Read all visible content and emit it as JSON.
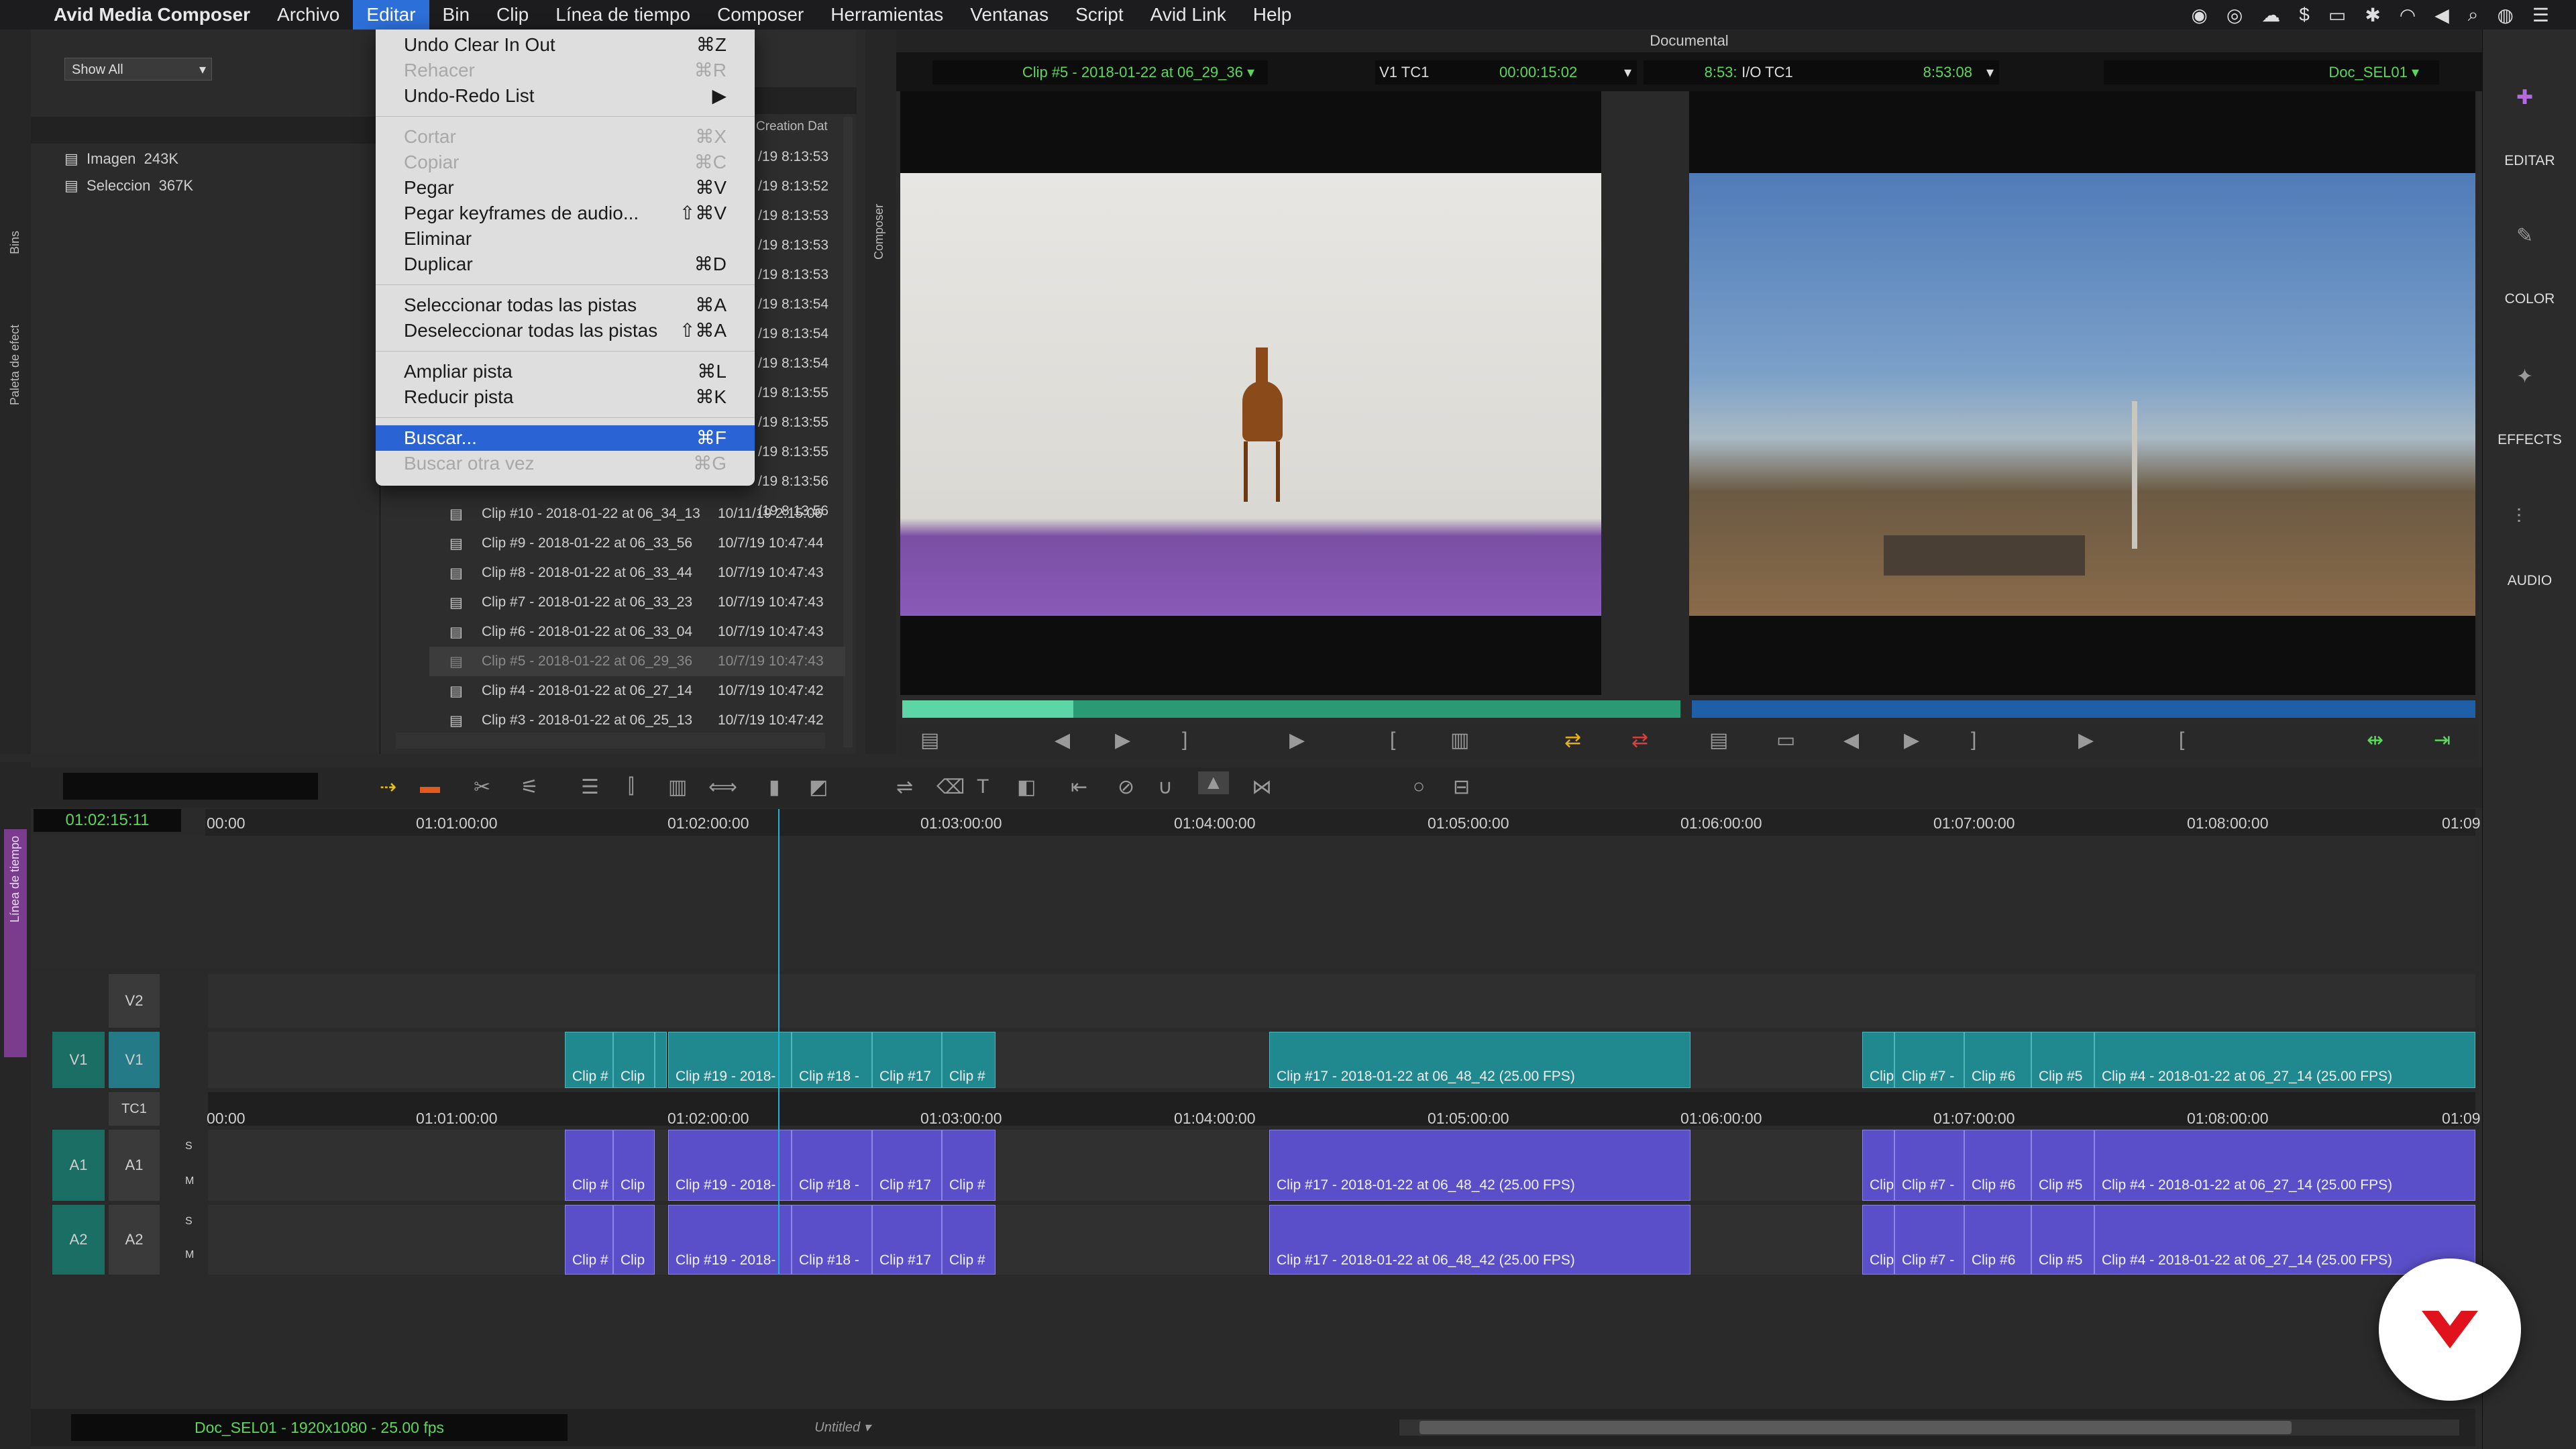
{
  "menubar": {
    "apple": "",
    "items": [
      "Avid Media Composer",
      "Archivo",
      "Editar",
      "Bin",
      "Clip",
      "Línea de tiempo",
      "Composer",
      "Herramientas",
      "Ventanas",
      "Script",
      "Avid Link",
      "Help"
    ],
    "active": "Editar"
  },
  "edit_menu": {
    "groups": [
      [
        {
          "label": "Undo Clear In Out",
          "shortcut": "⌘Z",
          "state": "enabled"
        },
        {
          "label": "Rehacer",
          "shortcut": "⌘R",
          "state": "disabled"
        },
        {
          "label": "Undo-Redo List",
          "shortcut": "▶",
          "state": "enabled"
        }
      ],
      [
        {
          "label": "Cortar",
          "shortcut": "⌘X",
          "state": "disabled"
        },
        {
          "label": "Copiar",
          "shortcut": "⌘C",
          "state": "disabled"
        },
        {
          "label": "Pegar",
          "shortcut": "⌘V",
          "state": "enabled"
        },
        {
          "label": "Pegar keyframes de audio...",
          "shortcut": "⇧⌘V",
          "state": "enabled"
        },
        {
          "label": "Eliminar",
          "shortcut": "",
          "state": "enabled"
        },
        {
          "label": "Duplicar",
          "shortcut": "⌘D",
          "state": "enabled"
        }
      ],
      [
        {
          "label": "Seleccionar todas las pistas",
          "shortcut": "⌘A",
          "state": "enabled"
        },
        {
          "label": "Deseleccionar todas las pistas",
          "shortcut": "⇧⌘A",
          "state": "enabled"
        }
      ],
      [
        {
          "label": "Ampliar pista",
          "shortcut": "⌘L",
          "state": "enabled"
        },
        {
          "label": "Reducir pista",
          "shortcut": "⌘K",
          "state": "enabled"
        }
      ],
      [
        {
          "label": "Buscar...",
          "shortcut": "⌘F",
          "state": "highlighted"
        },
        {
          "label": "Buscar otra vez",
          "shortcut": "⌘G",
          "state": "disabled"
        }
      ]
    ]
  },
  "project": {
    "show_filter": "Show All",
    "items": [
      {
        "name": "Imagen",
        "size": "243K"
      },
      {
        "name": "Seleccion",
        "size": "367K"
      }
    ],
    "side_tabs": [
      "Bins",
      "Paleta de efect"
    ]
  },
  "bin": {
    "col_header": "Creation Dat",
    "partial_times": [
      "/19 8:13:53",
      "/19 8:13:52",
      "/19 8:13:53",
      "/19 8:13:53",
      "/19 8:13:53",
      "/19 8:13:54",
      "/19 8:13:54",
      "/19 8:13:54",
      "/19 8:13:55",
      "/19 8:13:55",
      "/19 8:13:55",
      "/19 8:13:56",
      "/19 8:13:56"
    ],
    "rows": [
      {
        "name": "Clip #10 - 2018-01-22 at 06_34_13",
        "date": "10/11/19 2:15:06",
        "selected": false
      },
      {
        "name": "Clip #9 - 2018-01-22 at 06_33_56",
        "date": "10/7/19 10:47:44",
        "selected": false
      },
      {
        "name": "Clip #8 - 2018-01-22 at 06_33_44",
        "date": "10/7/19 10:47:43",
        "selected": false
      },
      {
        "name": "Clip #7 - 2018-01-22 at 06_33_23",
        "date": "10/7/19 10:47:43",
        "selected": false
      },
      {
        "name": "Clip #6 - 2018-01-22 at 06_33_04",
        "date": "10/7/19 10:47:43",
        "selected": false
      },
      {
        "name": "Clip #5 - 2018-01-22 at 06_29_36",
        "date": "10/7/19 10:47:43",
        "selected": true
      },
      {
        "name": "Clip #4 - 2018-01-22 at 06_27_14",
        "date": "10/7/19 10:47:42",
        "selected": false
      },
      {
        "name": "Clip #3 - 2018-01-22 at 06_25_13",
        "date": "10/7/19 10:47:42",
        "selected": false
      }
    ]
  },
  "composer": {
    "window_title": "Documental",
    "side_tab": "Composer",
    "source_clip": "Clip #5 - 2018-01-22 at 06_29_36",
    "readout1_label": "V1  TC1",
    "readout1_value": "00:00:15:02",
    "readout1_tc": "8:53:08",
    "readout2_label": "I/O  TC1",
    "readout2_value": "8:53:08",
    "record_seq": "Doc_SEL01"
  },
  "right_panel": {
    "items": [
      "EDITAR",
      "COLOR",
      "EFFECTS",
      "AUDIO"
    ]
  },
  "timeline": {
    "side_tab": "Línea de tiempo",
    "master_tc": "01:02:15:11",
    "ruler": [
      "00:00",
      "01:01:00:00",
      "01:02:00:00",
      "01:03:00:00",
      "01:04:00:00",
      "01:05:00:00",
      "01:06:00:00",
      "01:07:00:00",
      "01:08:00:00",
      "01:09"
    ],
    "tc_track_ruler": [
      "00:00",
      "01:01:00:00",
      "01:02:00:00",
      "01:03:00:00",
      "01:04:00:00",
      "01:05:00:00",
      "01:06:00:00",
      "01:07:00:00",
      "01:08:00:00",
      "01:09"
    ],
    "tracks": {
      "v2": "V2",
      "v1_src": "V1",
      "v1": "V1",
      "tc": "TC1",
      "a1_src": "A1",
      "a1": "A1",
      "a2_src": "A2",
      "a2": "A2",
      "s": "S",
      "m": "M"
    },
    "video_clips": [
      "Clip #",
      "Clip",
      "Clip #19 - 2018-",
      "Clip #18 -",
      "Clip #17",
      "Clip #",
      "Clip #17 - 2018-01-22 at 06_48_42 (25.00 FPS)",
      "Clip",
      "Clip #7 -",
      "Clip #6",
      "Clip #5",
      "Clip #4 - 2018-01-22 at 06_27_14 (25.00 FPS)"
    ],
    "audio_clips": [
      "Clip #",
      "Clip",
      "Clip #19 - 2018-",
      "Clip #18 -",
      "Clip #17",
      "Clip #",
      "Clip #17 - 2018-01-22 at 06_48_42 (25.00 FPS)",
      "Clip",
      "Clip #7 -",
      "Clip #6",
      "Clip #5",
      "Clip #4 - 2018-01-22 at 06_27_14 (25.00 FPS)"
    ],
    "status": "Doc_SEL01 - 1920x1080 - 25.00 fps",
    "untitled": "Untitled"
  },
  "colors": {
    "accent": "#2d6fd8",
    "video_clip": "#20898f",
    "audio_clip": "#5a4fc9",
    "timecode": "#5cd65c",
    "side_tab": "#7a3c8c"
  }
}
